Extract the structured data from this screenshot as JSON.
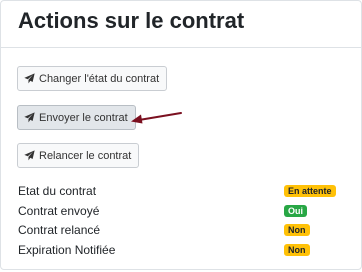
{
  "card": {
    "title": "Actions sur le contrat"
  },
  "buttons": {
    "change_state": "Changer l'état du contrat",
    "send_contract": "Envoyer le contrat",
    "remind_contract": "Relancer le contrat"
  },
  "status": {
    "items": [
      {
        "label": "Etat du contrat",
        "badge": "En attente",
        "variant": "warning"
      },
      {
        "label": "Contrat envoyé",
        "badge": "Oui",
        "variant": "success"
      },
      {
        "label": "Contrat relancé",
        "badge": "Non",
        "variant": "warning"
      },
      {
        "label": "Expiration Notifiée",
        "badge": "Non",
        "variant": "warning"
      }
    ]
  },
  "colors": {
    "warning": "#ffc107",
    "success": "#28a745",
    "annotation_arrow": "#7b1020"
  },
  "icons": {
    "button_icon": "paper-plane-icon"
  }
}
